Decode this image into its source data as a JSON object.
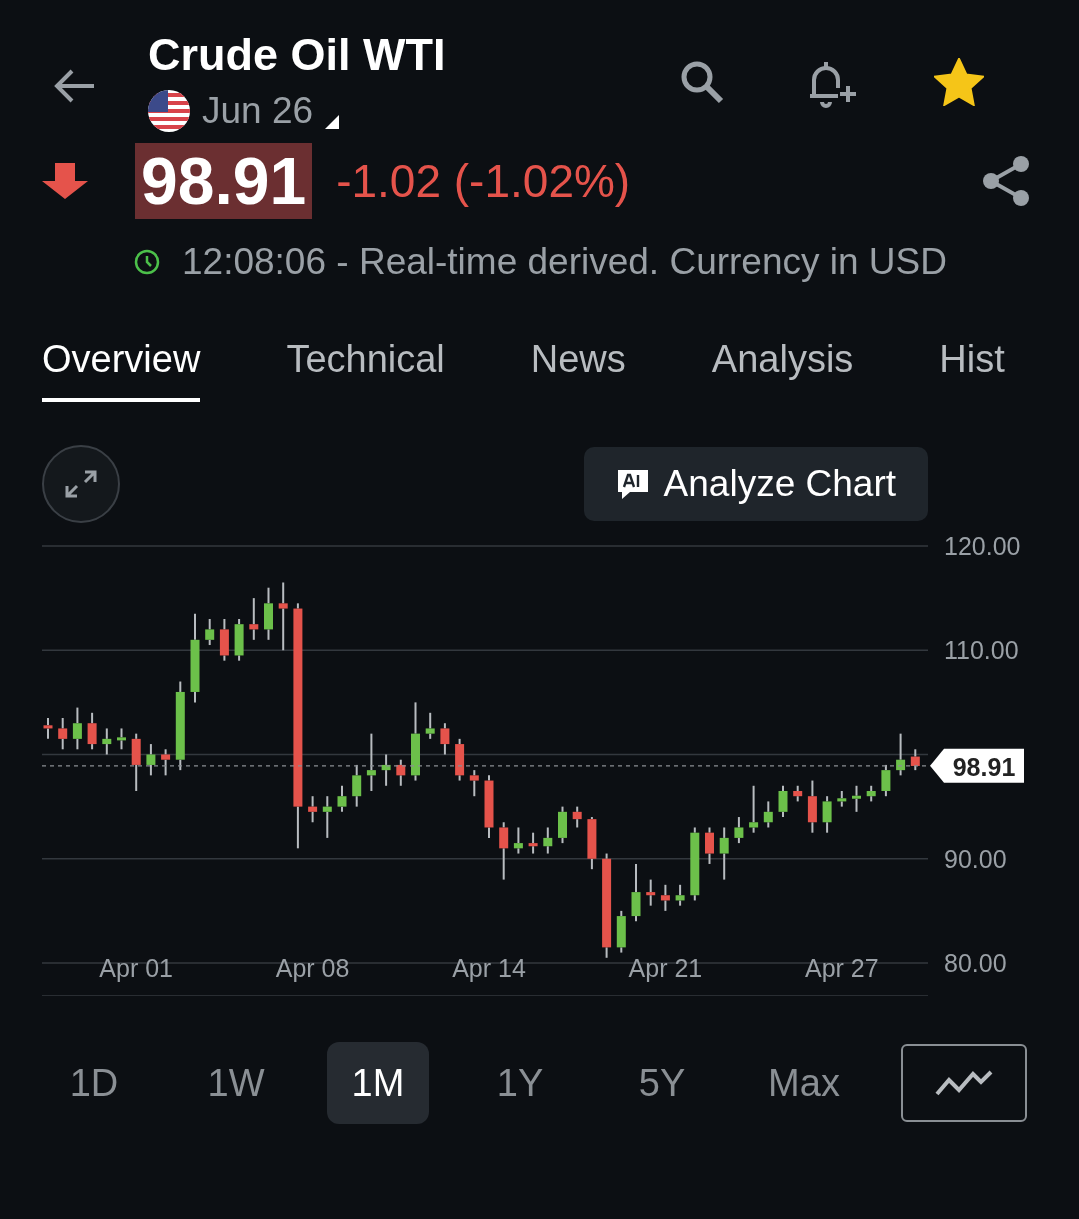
{
  "header": {
    "title": "Crude Oil WTI",
    "contract": "Jun 26",
    "favorite": true
  },
  "quote": {
    "price": "98.91",
    "falling": true,
    "change": "-1.02 (-1.02%)",
    "status": "12:08:06 - Real-time derived. Currency in USD"
  },
  "tabs": [
    {
      "label": "Overview",
      "selected": true
    },
    {
      "label": "Technical",
      "selected": false
    },
    {
      "label": "News",
      "selected": false
    },
    {
      "label": "Analysis",
      "selected": false
    },
    {
      "label": "Hist",
      "selected": false
    }
  ],
  "analyze_button": "Analyze Chart",
  "chart": {
    "chart_data": {
      "type": "candlestick",
      "ylim": [
        80,
        120
      ],
      "yticks": [
        {
          "value": 80,
          "label": "80.00"
        },
        {
          "value": 90,
          "label": "90.00"
        },
        {
          "value": 110,
          "label": "110.00"
        },
        {
          "value": 120,
          "label": "120.00"
        }
      ],
      "categories": [
        null,
        null,
        null,
        null,
        null,
        null,
        "Apr 01",
        null,
        null,
        null,
        null,
        null,
        null,
        null,
        null,
        null,
        null,
        null,
        "Apr 08",
        null,
        null,
        null,
        null,
        null,
        null,
        null,
        null,
        null,
        null,
        null,
        "Apr 14",
        null,
        null,
        null,
        null,
        null,
        null,
        null,
        null,
        null,
        null,
        null,
        "Apr 21",
        null,
        null,
        null,
        null,
        null,
        null,
        null,
        null,
        null,
        null,
        null,
        "Apr 27",
        null,
        null,
        null,
        null,
        null
      ],
      "ohlc": [
        [
          102.8,
          103.5,
          101.5,
          102.5
        ],
        [
          102.5,
          103.5,
          100.5,
          101.5
        ],
        [
          101.5,
          104.5,
          100.5,
          103
        ],
        [
          103,
          104,
          100.5,
          101
        ],
        [
          101,
          102.5,
          100,
          101.5
        ],
        [
          101.5,
          102.5,
          100.5,
          101.5
        ],
        [
          101.5,
          102,
          96.5,
          99
        ],
        [
          99,
          101,
          98,
          100
        ],
        [
          100,
          100.5,
          98,
          99.5
        ],
        [
          99.5,
          107,
          98.5,
          106
        ],
        [
          106,
          113.5,
          105,
          111
        ],
        [
          111,
          113,
          110.5,
          112
        ],
        [
          112,
          113,
          109,
          109.5
        ],
        [
          109.5,
          113,
          109,
          112.5
        ],
        [
          112.5,
          115,
          111,
          112
        ],
        [
          112,
          116,
          111,
          114.5
        ],
        [
          114.5,
          116.5,
          110,
          114
        ],
        [
          114,
          114.5,
          91,
          95
        ],
        [
          95,
          96,
          93.5,
          94.5
        ],
        [
          94.5,
          96,
          92,
          95
        ],
        [
          95,
          97,
          94.5,
          96
        ],
        [
          96,
          99,
          95,
          98
        ],
        [
          98,
          102,
          96.5,
          98.5
        ],
        [
          98.5,
          100,
          97,
          99
        ],
        [
          99,
          99.5,
          97,
          98
        ],
        [
          98,
          105,
          97.5,
          102
        ],
        [
          102,
          104,
          101.5,
          102.5
        ],
        [
          102.5,
          103,
          100,
          101
        ],
        [
          101,
          101.5,
          97.5,
          98
        ],
        [
          98,
          98.5,
          96,
          97.5
        ],
        [
          97.5,
          98,
          92,
          93
        ],
        [
          93,
          93.5,
          88,
          91
        ],
        [
          91,
          93,
          90.5,
          91.5
        ],
        [
          91.5,
          92.5,
          90.5,
          91.2
        ],
        [
          91.2,
          93,
          90.5,
          92
        ],
        [
          92,
          95,
          91.5,
          94.5
        ],
        [
          94.5,
          95,
          93,
          93.8
        ],
        [
          93.8,
          94,
          89,
          90
        ],
        [
          90,
          90.5,
          80.5,
          81.5
        ],
        [
          81.5,
          85,
          81,
          84.5
        ],
        [
          84.5,
          89.5,
          84,
          86.8
        ],
        [
          86.8,
          88,
          85.5,
          86.5
        ],
        [
          86.5,
          87.5,
          85,
          86
        ],
        [
          86,
          87.5,
          85.5,
          86.5
        ],
        [
          86.5,
          93,
          86,
          92.5
        ],
        [
          92.5,
          93,
          89.5,
          90.5
        ],
        [
          90.5,
          93,
          88,
          92
        ],
        [
          92,
          94,
          91.5,
          93
        ],
        [
          93,
          97,
          92.5,
          93.5
        ],
        [
          93.5,
          95.5,
          93,
          94.5
        ],
        [
          94.5,
          97,
          94,
          96.5
        ],
        [
          96.5,
          97,
          95.5,
          96
        ],
        [
          96,
          97.5,
          92.5,
          93.5
        ],
        [
          93.5,
          96,
          92.5,
          95.5
        ],
        [
          95.5,
          96.5,
          95,
          95.8
        ],
        [
          95.8,
          97,
          94.5,
          96
        ],
        [
          96,
          97,
          95.5,
          96.5
        ],
        [
          96.5,
          99,
          96,
          98.5
        ],
        [
          98.5,
          102,
          98,
          99.5
        ],
        [
          99.8,
          100.5,
          98.5,
          98.9
        ]
      ],
      "ref_lines": [
        {
          "axis": "y",
          "value": 98.91,
          "label": "98.91"
        }
      ]
    }
  },
  "ranges": [
    {
      "label": "1D",
      "selected": false
    },
    {
      "label": "1W",
      "selected": false
    },
    {
      "label": "1M",
      "selected": true
    },
    {
      "label": "1Y",
      "selected": false
    },
    {
      "label": "5Y",
      "selected": false
    },
    {
      "label": "Max",
      "selected": false
    }
  ]
}
